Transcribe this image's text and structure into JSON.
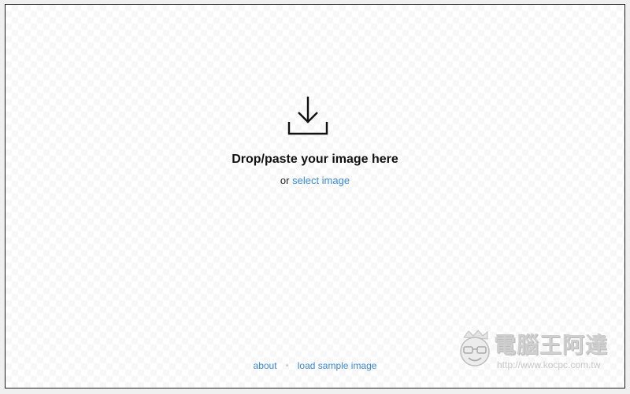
{
  "dropzone": {
    "icon": "download-tray-icon",
    "title": "Drop/paste your image here",
    "or_text": "or",
    "select_link": "select image"
  },
  "footer": {
    "about_link": "about",
    "separator": "•",
    "sample_link": "load sample image"
  },
  "watermark": {
    "brand": "電腦王阿達",
    "url": "http://www.kocpc.com.tw"
  },
  "colors": {
    "link": "#3a8ad8",
    "title": "#111111",
    "background": "#ffffff",
    "border": "#1a1a1a"
  }
}
